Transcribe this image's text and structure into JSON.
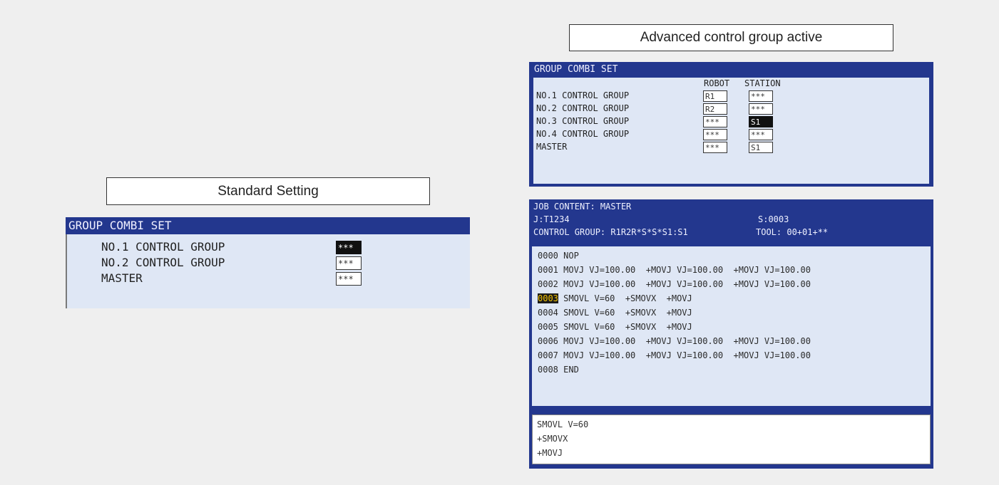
{
  "standard": {
    "caption": "Standard Setting",
    "title": "GROUP COMBI SET",
    "rows": [
      {
        "label": "NO.1 CONTROL GROUP",
        "value": "***"
      },
      {
        "label": "NO.2 CONTROL GROUP",
        "value": "***"
      },
      {
        "label": "MASTER",
        "value": "***"
      }
    ]
  },
  "advanced": {
    "caption": "Advanced control group active",
    "title": "GROUP COMBI SET",
    "col_robot": "ROBOT",
    "col_station": "STATION",
    "rows": [
      {
        "label": "NO.1 CONTROL GROUP",
        "robot": "R1",
        "station": "***"
      },
      {
        "label": "NO.2 CONTROL GROUP",
        "robot": "R2",
        "station": "***"
      },
      {
        "label": "NO.3 CONTROL GROUP",
        "robot": "***",
        "station": "S1"
      },
      {
        "label": "NO.4 CONTROL GROUP",
        "robot": "***",
        "station": "***"
      },
      {
        "label": "MASTER",
        "robot": "***",
        "station": "S1"
      }
    ]
  },
  "job": {
    "title": "JOB CONTENT: MASTER",
    "job_name": "J:T1234",
    "step": "S:0003",
    "control_group": "CONTROL GROUP: R1R2R*S*S*S1:S1",
    "tool": "TOOL: 00+01+**",
    "lines": [
      {
        "num": "0000",
        "text": "NOP"
      },
      {
        "num": "0001",
        "text": "MOVJ VJ=100.00  +MOVJ VJ=100.00  +MOVJ VJ=100.00"
      },
      {
        "num": "0002",
        "text": "MOVJ VJ=100.00  +MOVJ VJ=100.00  +MOVJ VJ=100.00"
      },
      {
        "num": "0003",
        "text": "SMOVL V=60  +SMOVX  +MOVJ"
      },
      {
        "num": "0004",
        "text": "SMOVL V=60  +SMOVX  +MOVJ"
      },
      {
        "num": "0005",
        "text": "SMOVL V=60  +SMOVX  +MOVJ"
      },
      {
        "num": "0006",
        "text": "MOVJ VJ=100.00  +MOVJ VJ=100.00  +MOVJ VJ=100.00"
      },
      {
        "num": "0007",
        "text": "MOVJ VJ=100.00  +MOVJ VJ=100.00  +MOVJ VJ=100.00"
      },
      {
        "num": "0008",
        "text": "END"
      }
    ],
    "detail": [
      "SMOVL V=60",
      "+SMOVX",
      "+MOVJ"
    ]
  }
}
